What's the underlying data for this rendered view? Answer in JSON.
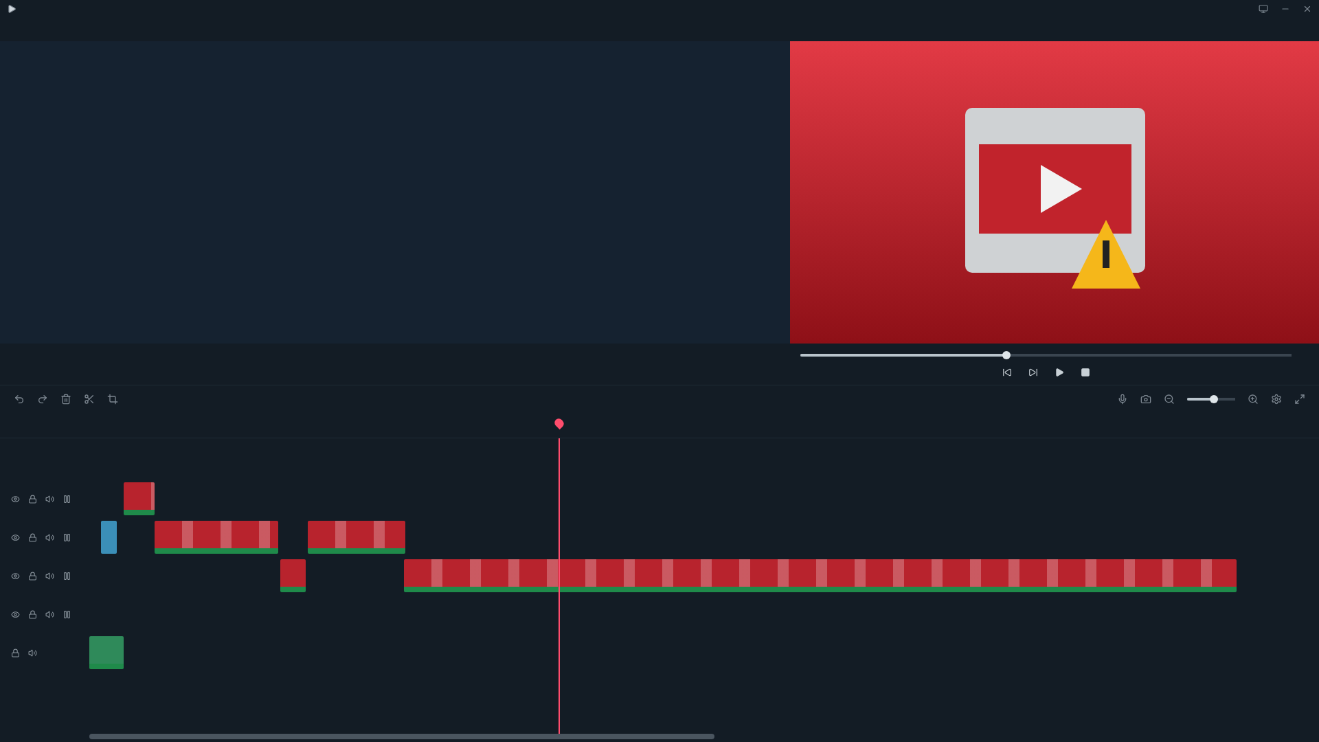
{
  "playback": {
    "level": 0.42
  },
  "zoom": {
    "level": 0.55
  },
  "tracks": [
    {
      "kind": "video",
      "clips": [
        {
          "kind": "video"
        }
      ]
    },
    {
      "kind": "video",
      "clips": [
        {
          "kind": "title"
        },
        {
          "kind": "video"
        },
        {
          "kind": "video"
        }
      ]
    },
    {
      "kind": "video",
      "clips": [
        {
          "kind": "video"
        },
        {
          "kind": "video"
        }
      ]
    },
    {
      "kind": "video"
    },
    {
      "kind": "audio",
      "clips": [
        {
          "kind": "audio"
        }
      ]
    }
  ]
}
